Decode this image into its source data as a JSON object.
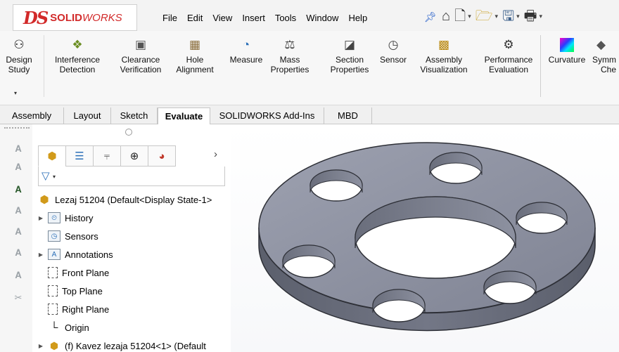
{
  "app": {
    "logo_ds": "DS",
    "logo_solid": "SOLID",
    "logo_works": "WORKS",
    "brand_color": "#d22a2a"
  },
  "menu": {
    "items": [
      "File",
      "Edit",
      "View",
      "Insert",
      "Tools",
      "Window",
      "Help"
    ],
    "pin_icon": "pin-icon"
  },
  "quick_access": {
    "icons": [
      "home-icon",
      "new-document-icon",
      "open-folder-icon",
      "save-icon",
      "print-icon"
    ]
  },
  "ribbon": {
    "design_study": {
      "line1": "Design",
      "line2": "Study",
      "icon": "design-study-icon"
    },
    "buttons": [
      {
        "line1": "Interference",
        "line2": "Detection",
        "icon": "interference-detection-icon"
      },
      {
        "line1": "Clearance",
        "line2": "Verification",
        "icon": "clearance-verification-icon"
      },
      {
        "line1": "Hole",
        "line2": "Alignment",
        "icon": "hole-alignment-icon"
      },
      {
        "line1": "Measure",
        "line2": "",
        "icon": "measure-icon"
      },
      {
        "line1": "Mass",
        "line2": "Properties",
        "icon": "mass-properties-icon"
      },
      {
        "line1": "Section",
        "line2": "Properties",
        "icon": "section-properties-icon"
      },
      {
        "line1": "Sensor",
        "line2": "",
        "icon": "sensor-icon"
      },
      {
        "line1": "Assembly",
        "line2": "Visualization",
        "icon": "assembly-visualization-icon"
      },
      {
        "line1": "Performance",
        "line2": "Evaluation",
        "icon": "performance-evaluation-icon"
      },
      {
        "line1": "Curvature",
        "line2": "",
        "icon": "curvature-icon"
      },
      {
        "line1": "Symm",
        "line2": "Che",
        "icon": "symmetry-check-icon"
      }
    ]
  },
  "tabs": [
    {
      "label": "Assembly",
      "active": false
    },
    {
      "label": "Layout",
      "active": false
    },
    {
      "label": "Sketch",
      "active": false
    },
    {
      "label": "Evaluate",
      "active": true
    },
    {
      "label": "SOLIDWORKS Add-Ins",
      "active": false
    },
    {
      "label": "MBD",
      "active": false
    }
  ],
  "feature_manager": {
    "tab_icons": [
      "featuremanager-tree-icon",
      "propertymanager-icon",
      "configurationmanager-icon",
      "dimxpertmanager-icon",
      "displaymanager-icon"
    ],
    "more_icon": "chevron-right-icon",
    "filter_icon": "filter-icon",
    "root": "Lezaj 51204  (Default<Display State-1>",
    "items": [
      {
        "label": "History",
        "icon": "history-icon",
        "expandable": true
      },
      {
        "label": "Sensors",
        "icon": "sensors-icon",
        "expandable": false
      },
      {
        "label": "Annotations",
        "icon": "annotations-icon",
        "expandable": true
      },
      {
        "label": "Front Plane",
        "icon": "plane-icon",
        "expandable": false
      },
      {
        "label": "Top Plane",
        "icon": "plane-icon",
        "expandable": false
      },
      {
        "label": "Right Plane",
        "icon": "plane-icon",
        "expandable": false
      },
      {
        "label": "Origin",
        "icon": "origin-icon",
        "expandable": false
      },
      {
        "label": "(f) Kavez lezaja 51204<1> (Default",
        "icon": "component-icon",
        "expandable": true
      }
    ]
  },
  "model": {
    "part_color": "#8a8e9c",
    "hole_count": 6
  }
}
